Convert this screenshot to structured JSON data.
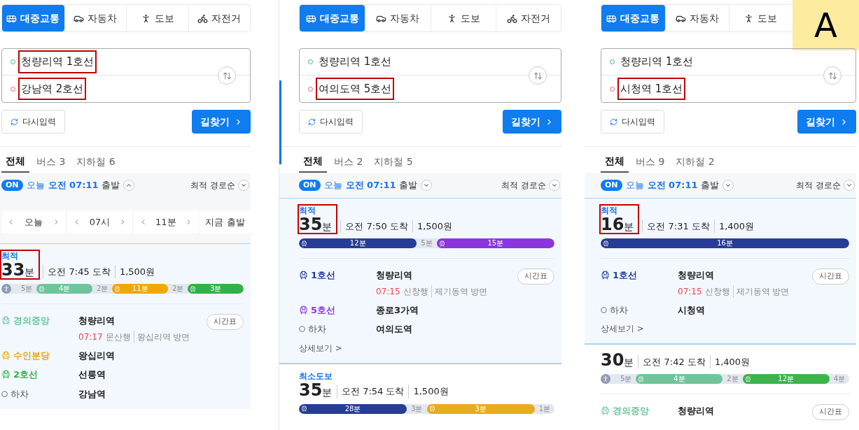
{
  "panels": [
    {
      "modes": [
        {
          "label": "대중교통",
          "selected": true
        },
        {
          "label": "자동차",
          "selected": false
        },
        {
          "label": "도보",
          "selected": false
        },
        {
          "label": "자전거",
          "selected": false
        }
      ],
      "origin": {
        "value": "청량리역 1호선",
        "highlighted": true
      },
      "destination": {
        "value": "강남역 2호선",
        "highlighted": true
      },
      "reset_button": "다시입력",
      "search_button": "길찾기",
      "filters": [
        {
          "label": "전체",
          "selected": true
        },
        {
          "label": "버스 3",
          "selected": false
        },
        {
          "label": "지하철 6",
          "selected": false
        }
      ],
      "departure": {
        "toggle": "ON",
        "day": "오늘",
        "time": "오전 07:11",
        "suffix": "출발",
        "expanded": true
      },
      "sort": "최적 경로순",
      "time_picker": [
        "오늘",
        "07시",
        "11분"
      ],
      "now_button": "지금 출발",
      "routes": [
        {
          "badge": "최적",
          "duration": "33",
          "unit": "분",
          "arrival": "오전 7:45 도착",
          "fare": "1,500원",
          "highlighted": true,
          "selected": true,
          "segments": [
            {
              "kind": "walk",
              "label": "5분"
            },
            {
              "kind": "ride",
              "label": "4분",
              "color": "#6fc49c"
            },
            {
              "kind": "walk",
              "label": "2분"
            },
            {
              "kind": "ride",
              "label": "11분",
              "color": "#eea800"
            },
            {
              "kind": "walk",
              "label": "2분"
            },
            {
              "kind": "ride",
              "label": "3분",
              "color": "#34b04a"
            }
          ],
          "legs": [
            {
              "kind": "ride",
              "line": "경의중앙",
              "color": "#6fc49c",
              "station": "청량리역",
              "departure": {
                "time": "07:17",
                "direction": "문산행",
                "platform": "왕십리역 방면"
              },
              "timetable": "시간표"
            },
            {
              "kind": "ride",
              "line": "수인분당",
              "color": "#eea800",
              "station": "왕십리역"
            },
            {
              "kind": "ride",
              "line": "2호선",
              "color": "#34b04a",
              "station": "선릉역"
            },
            {
              "kind": "alight",
              "line": "하차",
              "station": "강남역"
            }
          ]
        }
      ]
    },
    {
      "modes": [
        {
          "label": "대중교통",
          "selected": true
        },
        {
          "label": "자동차",
          "selected": false
        },
        {
          "label": "도보",
          "selected": false
        },
        {
          "label": "자전거",
          "selected": false
        }
      ],
      "origin": {
        "value": "청량리역 1호선",
        "highlighted": false
      },
      "destination": {
        "value": "여의도역 5호선",
        "highlighted": true
      },
      "reset_button": "다시입력",
      "search_button": "길찾기",
      "filters": [
        {
          "label": "전체",
          "selected": true
        },
        {
          "label": "버스 2",
          "selected": false
        },
        {
          "label": "지하철 5",
          "selected": false
        }
      ],
      "departure": {
        "toggle": "ON",
        "day": "오늘",
        "time": "오전 07:11",
        "suffix": "출발",
        "expanded": false
      },
      "sort": "최적 경로순",
      "routes": [
        {
          "badge": "최적",
          "duration": "35",
          "unit": "분",
          "arrival": "오전 7:50 도착",
          "fare": "1,500원",
          "highlighted": true,
          "selected": true,
          "segments": [
            {
              "kind": "ride",
              "label": "12분",
              "color": "#263c96"
            },
            {
              "kind": "walk",
              "label": "5분"
            },
            {
              "kind": "ride",
              "label": "15분",
              "color": "#8a36dc"
            }
          ],
          "legs": [
            {
              "kind": "ride",
              "line": "1호선",
              "color": "#263c96",
              "station": "청량리역",
              "departure": {
                "time": "07:15",
                "direction": "신창행",
                "platform": "제기동역 방면"
              },
              "timetable": "시간표"
            },
            {
              "kind": "ride",
              "line": "5호선",
              "color": "#8a36dc",
              "station": "종로3가역"
            },
            {
              "kind": "alight",
              "line": "하차",
              "station": "여의도역"
            }
          ],
          "details": "상세보기 >"
        },
        {
          "badge": "최소도보",
          "duration": "35",
          "unit": "분",
          "arrival": "오전 7:54 도착",
          "fare": "1,500원",
          "highlighted": false,
          "selected": false,
          "segments": [
            {
              "kind": "ride",
              "label": "28분",
              "color": "#263c96"
            },
            {
              "kind": "walk",
              "label": "3분"
            },
            {
              "kind": "ride",
              "label": "3분",
              "color": "#e8ac1c"
            },
            {
              "kind": "walk",
              "label": "1분"
            }
          ]
        }
      ]
    },
    {
      "modes": [
        {
          "label": "대중교통",
          "selected": true
        },
        {
          "label": "자동차",
          "selected": false
        },
        {
          "label": "도보",
          "selected": false
        }
      ],
      "corner_label": "A",
      "origin": {
        "value": "청량리역 1호선",
        "highlighted": false
      },
      "destination": {
        "value": "시청역 1호선",
        "highlighted": true
      },
      "reset_button": "다시입력",
      "search_button": "길찾기",
      "filters": [
        {
          "label": "전체",
          "selected": true
        },
        {
          "label": "버스 9",
          "selected": false
        },
        {
          "label": "지하철 2",
          "selected": false
        }
      ],
      "departure": {
        "toggle": "ON",
        "day": "오늘",
        "time": "오전 07:11",
        "suffix": "출발",
        "expanded": false
      },
      "sort": "최적 경로순",
      "routes": [
        {
          "badge": "최적",
          "duration": "16",
          "unit": "분",
          "arrival": "오전 7:31 도착",
          "fare": "1,400원",
          "highlighted": true,
          "selected": true,
          "segments": [
            {
              "kind": "ride",
              "label": "16분",
              "color": "#263c96"
            }
          ],
          "legs": [
            {
              "kind": "ride",
              "line": "1호선",
              "color": "#263c96",
              "station": "청량리역",
              "departure": {
                "time": "07:15",
                "direction": "신창행",
                "platform": "제기동역 방면"
              },
              "timetable": "시간표"
            },
            {
              "kind": "alight",
              "line": "하차",
              "station": "시청역"
            }
          ],
          "details": "상세보기 >"
        },
        {
          "duration": "30",
          "unit": "분",
          "arrival": "오전 7:42 도착",
          "fare": "1,400원",
          "highlighted": false,
          "selected": false,
          "segments": [
            {
              "kind": "walk",
              "label": "5분"
            },
            {
              "kind": "ride",
              "label": "4분",
              "color": "#6fc49c"
            },
            {
              "kind": "walk",
              "label": "2분"
            },
            {
              "kind": "ride",
              "label": "12분",
              "color": "#3cb44b"
            },
            {
              "kind": "walk",
              "label": "4분"
            }
          ],
          "legs": [
            {
              "kind": "ride",
              "line": "경의중앙",
              "color": "#6fc49c",
              "station": "청량리역",
              "timetable": "시간표"
            }
          ]
        }
      ]
    }
  ]
}
